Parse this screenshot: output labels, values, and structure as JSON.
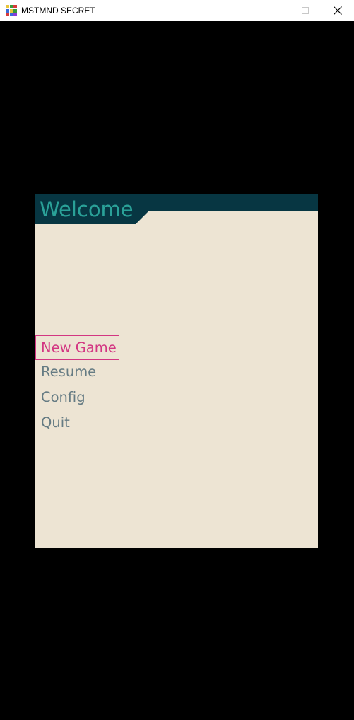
{
  "window": {
    "title": "MSTMND SECRET",
    "icon": "app-grid-icon",
    "controls": {
      "minimize_icon": "minimize-icon",
      "maximize_icon": "maximize-icon",
      "close_icon": "close-icon"
    }
  },
  "panel": {
    "title": "Welcome",
    "background_color": "#ede4d3",
    "header_color": "#073642",
    "title_color": "#2aa198"
  },
  "menu": {
    "items": [
      {
        "label": "New Game",
        "selected": true
      },
      {
        "label": "Resume",
        "selected": false
      },
      {
        "label": "Config",
        "selected": false
      },
      {
        "label": "Quit",
        "selected": false
      }
    ],
    "selected_color": "#d33682",
    "item_color": "#657b83"
  }
}
